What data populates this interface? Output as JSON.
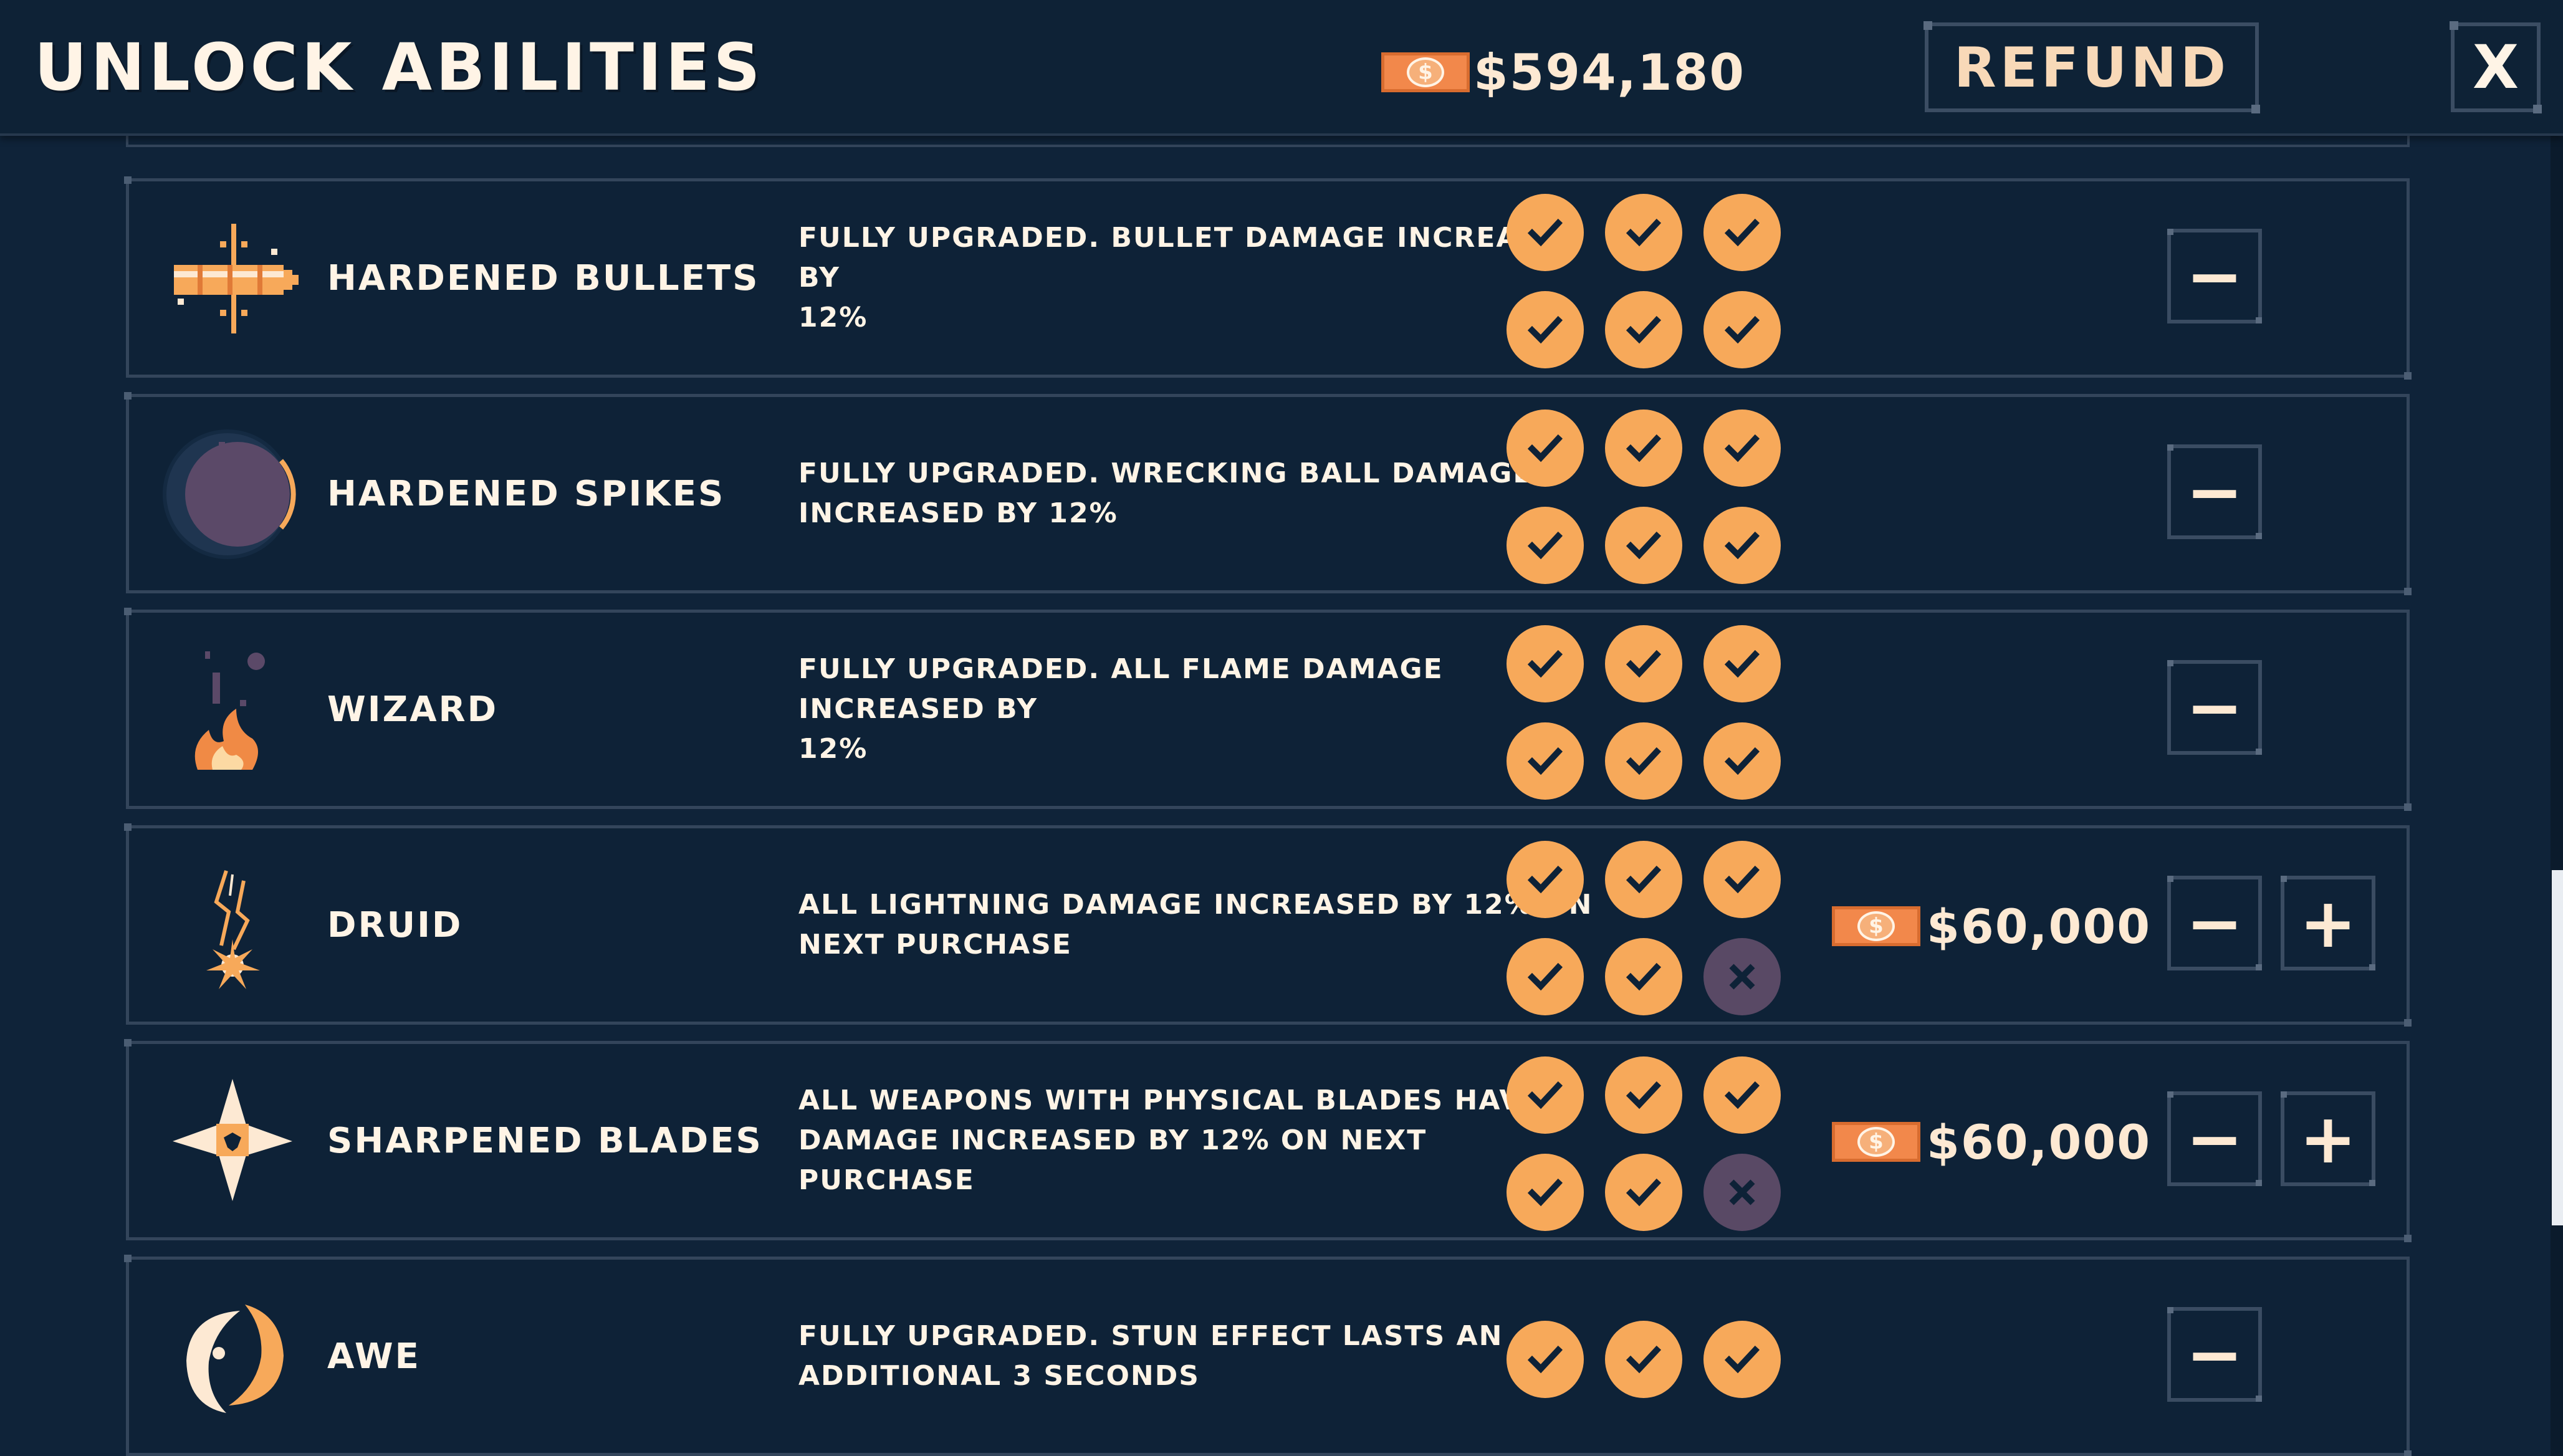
{
  "header": {
    "title": "UNLOCK ABILITIES",
    "money": "$594,180",
    "refund_label": "REFUND",
    "close_label": "X"
  },
  "colors": {
    "accent": "#f7a95a",
    "locked": "#594965",
    "background": "#0f2339"
  },
  "abilities": [
    {
      "name": "HARDENED BULLETS",
      "desc_line1": "FULLY UPGRADED. BULLET DAMAGE INCREASED BY",
      "desc_line2": "12%",
      "icon": "bullet-icon",
      "minus": "−",
      "plus": "",
      "price": ""
    },
    {
      "name": "HARDENED SPIKES",
      "desc_line1": "FULLY UPGRADED. WRECKING BALL DAMAGE",
      "desc_line2": "INCREASED BY 12%",
      "icon": "wrecking-ball-icon",
      "minus": "−",
      "plus": "",
      "price": ""
    },
    {
      "name": "WIZARD",
      "desc_line1": "FULLY UPGRADED. ALL FLAME DAMAGE INCREASED BY",
      "desc_line2": "12%",
      "icon": "flame-icon",
      "minus": "−",
      "plus": "",
      "price": ""
    },
    {
      "name": "DRUID",
      "desc_line1": "ALL LIGHTNING DAMAGE INCREASED BY 12% ON",
      "desc_line2": "NEXT PURCHASE",
      "icon": "lightning-icon",
      "minus": "−",
      "plus": "+",
      "price": "$60,000"
    },
    {
      "name": "SHARPENED BLADES",
      "desc_line1": "ALL WEAPONS WITH PHYSICAL BLADES HAVE",
      "desc_line2": "DAMAGE INCREASED BY 12% ON NEXT PURCHASE",
      "icon": "shuriken-icon",
      "minus": "−",
      "plus": "+",
      "price": "$60,000"
    },
    {
      "name": "AWE",
      "desc_line1": "FULLY UPGRADED. STUN EFFECT LASTS AN",
      "desc_line2": "ADDITIONAL 3 SECONDS",
      "icon": "stun-swirl-icon",
      "minus": "−",
      "plus": "",
      "price": ""
    }
  ],
  "upgrades": [
    {
      "levels": 6,
      "unlocked": 6
    },
    {
      "levels": 6,
      "unlocked": 6
    },
    {
      "levels": 6,
      "unlocked": 6
    },
    {
      "levels": 6,
      "unlocked": 5
    },
    {
      "levels": 6,
      "unlocked": 5
    },
    {
      "levels": 3,
      "unlocked": 3
    }
  ],
  "currency_symbol": "$"
}
